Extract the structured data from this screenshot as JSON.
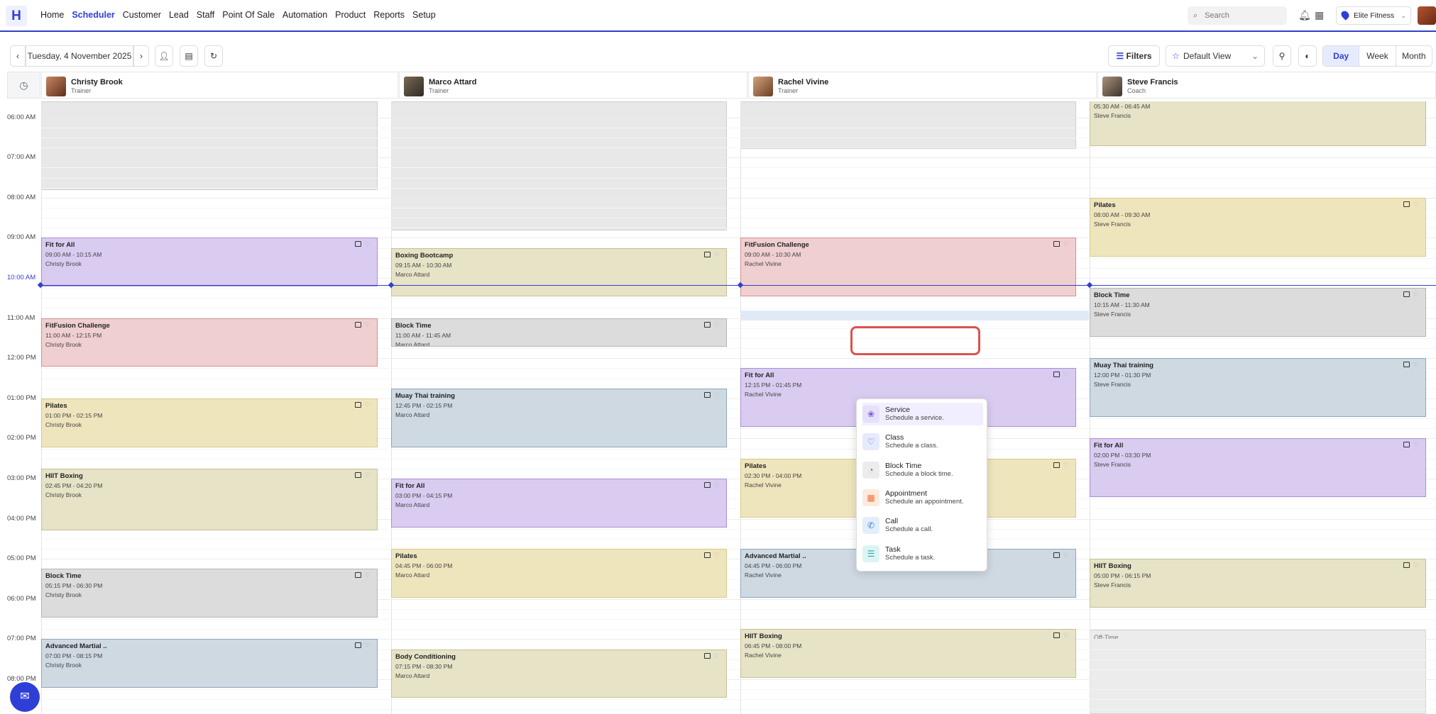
{
  "app": {
    "logo": "H"
  },
  "nav": {
    "items": [
      "Home",
      "Scheduler",
      "Customer",
      "Lead",
      "Staff",
      "Point Of Sale",
      "Automation",
      "Product",
      "Reports",
      "Setup"
    ],
    "active": "Scheduler",
    "search_placeholder": "Search",
    "location": "Elite Fitness"
  },
  "toolbar": {
    "date": "Tuesday, 4 November 2025",
    "filters_label": "Filters",
    "view_label": "Default View",
    "segments": [
      "Day",
      "Week",
      "Month"
    ],
    "active_segment": "Day"
  },
  "staff": [
    {
      "name": "Christy Brook",
      "role": "Trainer"
    },
    {
      "name": "Marco Attard",
      "role": "Trainer"
    },
    {
      "name": "Rachel Vivine",
      "role": "Trainer"
    },
    {
      "name": "Steve Francis",
      "role": "Coach"
    }
  ],
  "time_labels": [
    "06:00 AM",
    "07:00 AM",
    "08:00 AM",
    "09:00 AM",
    "10:00 AM",
    "11:00 AM",
    "12:00 PM",
    "01:00 PM",
    "02:00 PM",
    "03:00 PM",
    "04:00 PM",
    "05:00 PM",
    "06:00 PM",
    "07:00 PM",
    "08:00 PM"
  ],
  "events": {
    "c0": [
      {
        "title": "Fit for All",
        "time": "09:00 AM - 10:15 AM",
        "staff": "Christy Brook",
        "color": "purple"
      },
      {
        "title": "FitFusion Challenge",
        "time": "11:00 AM - 12:15 PM",
        "staff": "Christy Brook",
        "color": "pink"
      },
      {
        "title": "Pilates",
        "time": "01:00 PM - 02:15 PM",
        "staff": "Christy Brook",
        "color": "yellow"
      },
      {
        "title": "HIIT Boxing",
        "time": "02:45 PM - 04:20 PM",
        "staff": "Christy Brook",
        "color": "olive"
      },
      {
        "title": "Block Time",
        "time": "05:15 PM - 06:30 PM",
        "staff": "Christy Brook",
        "color": "grey"
      },
      {
        "title": "Advanced Martial ..",
        "time": "07:00 PM - 08:15 PM",
        "staff": "Christy Brook",
        "color": "blue"
      }
    ],
    "c1": [
      {
        "title": "Boxing Bootcamp",
        "time": "09:15 AM - 10:30 AM",
        "staff": "Marco Attard",
        "color": "olive"
      },
      {
        "title": "Block Time",
        "time": "11:00 AM - 11:45 AM",
        "staff": "Marco Attard",
        "color": "grey"
      },
      {
        "title": "Muay Thai training",
        "time": "12:45 PM - 02:15 PM",
        "staff": "Marco Attard",
        "color": "blue"
      },
      {
        "title": "Fit for All",
        "time": "03:00 PM - 04:15 PM",
        "staff": "Marco Attard",
        "color": "purple"
      },
      {
        "title": "Pilates",
        "time": "04:45 PM - 06:00 PM",
        "staff": "Marco Attard",
        "color": "yellow"
      },
      {
        "title": "Body Conditioning",
        "time": "07:15 PM - 08:30 PM",
        "staff": "Marco Attard",
        "color": "olive"
      }
    ],
    "c2": [
      {
        "title": "FitFusion Challenge",
        "time": "09:00 AM - 10:30 AM",
        "staff": "Rachel Vivine",
        "color": "pink"
      },
      {
        "title": "Fit for All",
        "time": "12:15 PM - 01:45 PM",
        "staff": "Rachel Vivine",
        "color": "purple"
      },
      {
        "title": "Pilates",
        "time": "02:30 PM - 04:00 PM",
        "staff": "Rachel Vivine",
        "color": "yellow"
      },
      {
        "title": "Advanced Martial ..",
        "time": "04:45 PM - 06:00 PM",
        "staff": "Rachel Vivine",
        "color": "blue"
      },
      {
        "title": "HIIT Boxing",
        "time": "06:45 PM - 08:00 PM",
        "staff": "Rachel Vivine",
        "color": "olive"
      }
    ],
    "c3": [
      {
        "title": "",
        "time": "05:30 AM - 06:45 AM",
        "staff": "Steve Francis",
        "color": "olive"
      },
      {
        "title": "Pilates",
        "time": "08:00 AM - 09:30 AM",
        "staff": "Steve Francis",
        "color": "yellow"
      },
      {
        "title": "Block Time",
        "time": "10:15 AM - 11:30 AM",
        "staff": "Steve Francis",
        "color": "grey"
      },
      {
        "title": "Muay Thai training",
        "time": "12:00 PM - 01:30 PM",
        "staff": "Steve Francis",
        "color": "blue"
      },
      {
        "title": "Fit for All",
        "time": "02:00 PM - 03:30 PM",
        "staff": "Steve Francis",
        "color": "purple"
      },
      {
        "title": "HIIT Boxing",
        "time": "05:00 PM - 06:15 PM",
        "staff": "Steve Francis",
        "color": "olive"
      }
    ]
  },
  "off_time_label": "Off-Time",
  "popup": {
    "items": [
      {
        "title": "Service",
        "desc": "Schedule a service.",
        "icon": "lotus-icon",
        "icon_color": "#7b5cd6"
      },
      {
        "title": "Class",
        "desc": "Schedule a class.",
        "icon": "heartbeat-icon",
        "icon_color": "#5b6bd6"
      },
      {
        "title": "Block Time",
        "desc": "Schedule a block time.",
        "icon": "user-clock-icon",
        "icon_color": "#777777"
      },
      {
        "title": "Appointment",
        "desc": "Schedule an appointment.",
        "icon": "calendar-grid-icon",
        "icon_color": "#e8733a"
      },
      {
        "title": "Call",
        "desc": "Schedule a call.",
        "icon": "phone-icon",
        "icon_color": "#3a7fd6"
      },
      {
        "title": "Task",
        "desc": "Schedule a task.",
        "icon": "checklist-icon",
        "icon_color": "#27a3a3"
      }
    ],
    "highlighted": "Service"
  }
}
